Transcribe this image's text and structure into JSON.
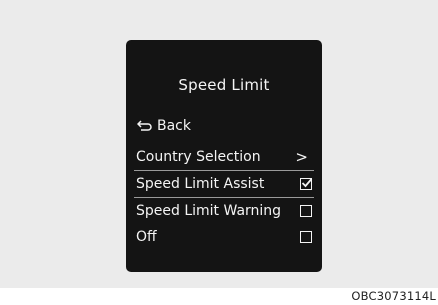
{
  "screen": {
    "title": "Speed Limit",
    "back_label": "Back",
    "menu_items": [
      {
        "label": "Country Selection",
        "control": "chevron",
        "glyph": ">"
      },
      {
        "label": "Speed Limit Assist",
        "control": "checkbox",
        "checked": true
      },
      {
        "label": "Speed Limit Warning",
        "control": "checkbox",
        "checked": false
      },
      {
        "label": "Off",
        "control": "checkbox",
        "checked": false
      }
    ]
  },
  "image_code": "OBC3073114L",
  "colors": {
    "screen_background": "#141414",
    "text": "#f4f4f4",
    "panel_background": "#ebebeb"
  }
}
